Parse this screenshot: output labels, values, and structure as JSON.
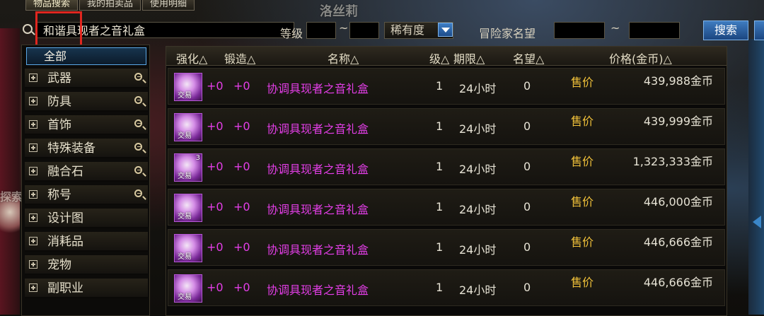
{
  "tabs": [
    {
      "label": "物品搜索",
      "active": true
    },
    {
      "label": "我的拍卖品",
      "active": false
    },
    {
      "label": "使用明细",
      "active": false
    }
  ],
  "background_texts": [
    "洛丝莉",
    "探索"
  ],
  "search": {
    "value": "和谐具现者之音礼盒",
    "level_label": "等级",
    "level_tilde": "~",
    "rarity_label": "稀有度",
    "fame_label": "冒险家名望",
    "fame_tilde": "~",
    "search_button": "搜索"
  },
  "categories": {
    "all": "全部",
    "items": [
      {
        "label": "武器",
        "zoom": true
      },
      {
        "label": "防具",
        "zoom": true
      },
      {
        "label": "首饰",
        "zoom": true
      },
      {
        "label": "特殊装备",
        "zoom": true
      },
      {
        "label": "融合石",
        "zoom": true
      },
      {
        "label": "称号",
        "zoom": true
      },
      {
        "label": "设计图",
        "zoom": false
      },
      {
        "label": "消耗品",
        "zoom": false
      },
      {
        "label": "宠物",
        "zoom": false
      },
      {
        "label": "副职业",
        "zoom": false
      }
    ]
  },
  "table": {
    "headers": {
      "reinforce": "强化△",
      "forge": "锻造△",
      "name": "名称△",
      "level": "级△",
      "period": "期限△",
      "fame": "名望△",
      "price": "价格(金币)△"
    },
    "rows": [
      {
        "trade": "交易",
        "stack": "",
        "reinforce": "+0",
        "forge": "+0",
        "name": "协调具现者之音礼盒",
        "level": "1",
        "period": "24小时",
        "fame": "0",
        "price_label": "售价",
        "price": "439,988金币"
      },
      {
        "trade": "交易",
        "stack": "",
        "reinforce": "+0",
        "forge": "+0",
        "name": "协调具现者之音礼盒",
        "level": "1",
        "period": "24小时",
        "fame": "0",
        "price_label": "售价",
        "price": "439,999金币"
      },
      {
        "trade": "交易",
        "stack": "3",
        "reinforce": "+0",
        "forge": "+0",
        "name": "协调具现者之音礼盒",
        "level": "1",
        "period": "24小时",
        "fame": "0",
        "price_label": "售价",
        "price": "1,323,333金币"
      },
      {
        "trade": "交易",
        "stack": "",
        "reinforce": "+0",
        "forge": "+0",
        "name": "协调具现者之音礼盒",
        "level": "1",
        "period": "24小时",
        "fame": "0",
        "price_label": "售价",
        "price": "446,000金币"
      },
      {
        "trade": "交易",
        "stack": "",
        "reinforce": "+0",
        "forge": "+0",
        "name": "协调具现者之音礼盒",
        "level": "1",
        "period": "24小时",
        "fame": "0",
        "price_label": "售价",
        "price": "446,666金币"
      },
      {
        "trade": "交易",
        "stack": "",
        "reinforce": "+0",
        "forge": "+0",
        "name": "协调具现者之音礼盒",
        "level": "1",
        "period": "24小时",
        "fame": "0",
        "price_label": "售价",
        "price": "446,666金币"
      }
    ]
  },
  "colors": {
    "item_name": "#e43ee8",
    "price_label": "#f2c23a",
    "highlight": "#e0261f",
    "button": "#3f7cc0"
  }
}
